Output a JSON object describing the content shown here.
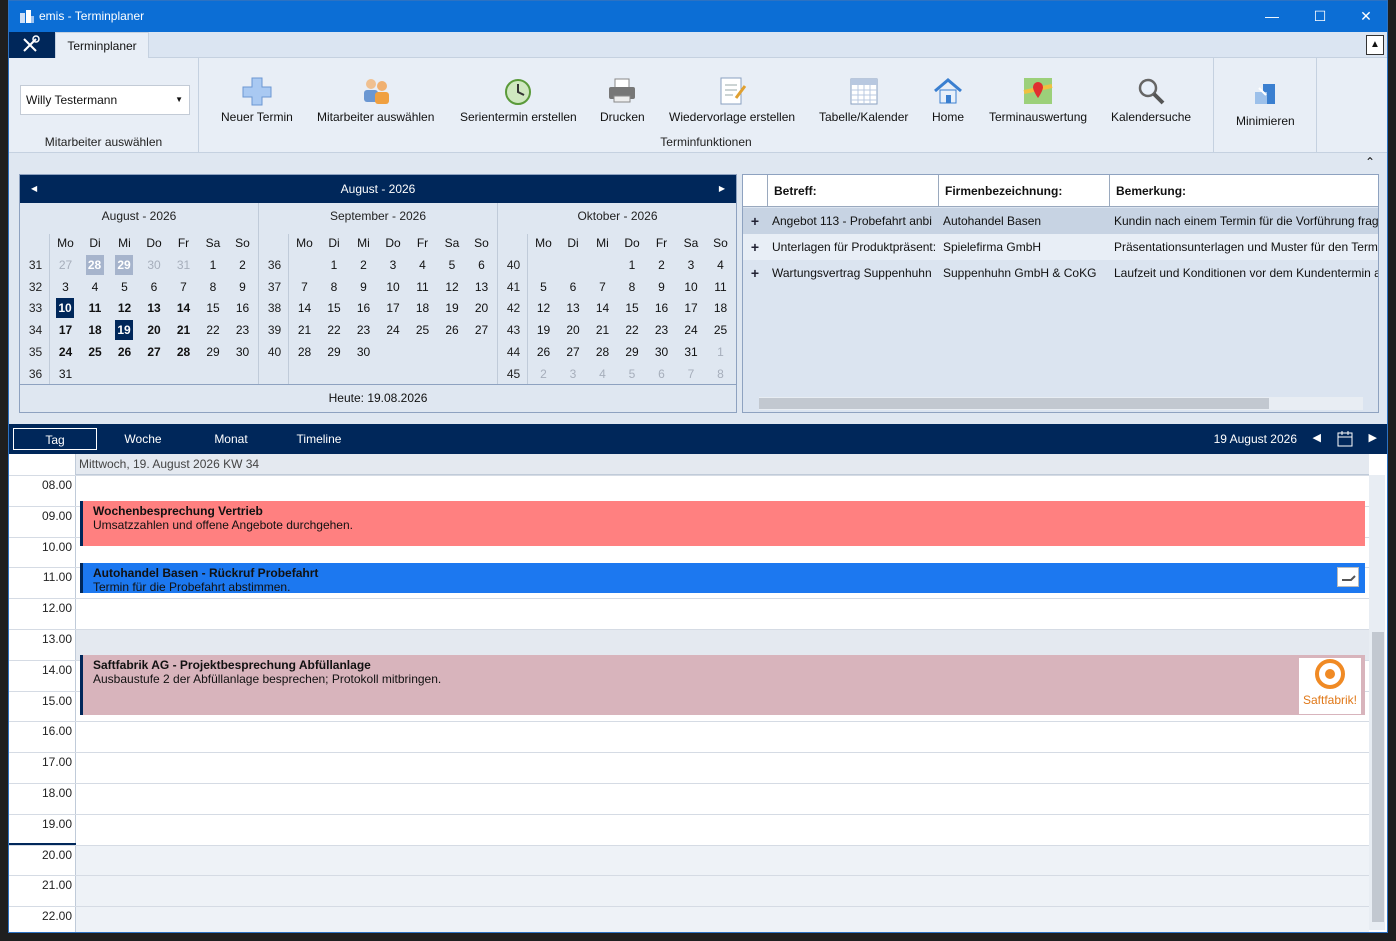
{
  "window": {
    "title": "emis - Terminplaner"
  },
  "ribbon": {
    "tab": "Terminplaner",
    "employee": {
      "value": "Willy Testermann",
      "group_label": "Mitarbeiter auswählen"
    },
    "buttons": [
      "Neuer Termin",
      "Mitarbeiter auswählen",
      "Serientermin erstellen",
      "Drucken",
      "Wiedervorlage erstellen",
      "Tabelle/Kalender",
      "Home",
      "Terminauswertung",
      "Kalendersuche"
    ],
    "group_label": "Terminfunktionen",
    "minimize": "Minimieren"
  },
  "calendar": {
    "header": "August - 2026",
    "today": "Heute: 19.08.2026",
    "weekdays": [
      "Mo",
      "Di",
      "Mi",
      "Do",
      "Fr",
      "Sa",
      "So"
    ],
    "months": [
      {
        "title": "August - 2026",
        "weeks": [
          {
            "wk": "31",
            "days": [
              [
                "27",
                "dim"
              ],
              [
                "28",
                "pastsel"
              ],
              [
                "29",
                "pastsel"
              ],
              [
                "30",
                "dim"
              ],
              [
                "31",
                "dim"
              ],
              [
                "1",
                ""
              ],
              [
                "2",
                ""
              ]
            ]
          },
          {
            "wk": "32",
            "days": [
              [
                "3",
                ""
              ],
              [
                "4",
                ""
              ],
              [
                "5",
                ""
              ],
              [
                "6",
                ""
              ],
              [
                "7",
                ""
              ],
              [
                "8",
                ""
              ],
              [
                "9",
                ""
              ]
            ]
          },
          {
            "wk": "33",
            "days": [
              [
                "10",
                "selday"
              ],
              [
                "11",
                "bold"
              ],
              [
                "12",
                "bold"
              ],
              [
                "13",
                "bold"
              ],
              [
                "14",
                "bold"
              ],
              [
                "15",
                ""
              ],
              [
                "16",
                ""
              ]
            ]
          },
          {
            "wk": "34",
            "days": [
              [
                "17",
                "bold"
              ],
              [
                "18",
                "bold"
              ],
              [
                "19",
                "selday"
              ],
              [
                "20",
                "bold"
              ],
              [
                "21",
                "bold"
              ],
              [
                "22",
                ""
              ],
              [
                "23",
                ""
              ]
            ]
          },
          {
            "wk": "35",
            "days": [
              [
                "24",
                "bold"
              ],
              [
                "25",
                "bold"
              ],
              [
                "26",
                "bold"
              ],
              [
                "27",
                "bold"
              ],
              [
                "28",
                "bold"
              ],
              [
                "29",
                ""
              ],
              [
                "30",
                ""
              ]
            ]
          },
          {
            "wk": "36",
            "days": [
              [
                "31",
                ""
              ],
              [
                "",
                ""
              ],
              [
                "",
                ""
              ],
              [
                "",
                ""
              ],
              [
                "",
                ""
              ],
              [
                "",
                ""
              ],
              [
                "",
                ""
              ]
            ]
          }
        ]
      },
      {
        "title": "September - 2026",
        "weeks": [
          {
            "wk": "36",
            "days": [
              [
                "",
                ""
              ],
              [
                "1",
                ""
              ],
              [
                "2",
                ""
              ],
              [
                "3",
                ""
              ],
              [
                "4",
                ""
              ],
              [
                "5",
                ""
              ],
              [
                "6",
                ""
              ]
            ]
          },
          {
            "wk": "37",
            "days": [
              [
                "7",
                ""
              ],
              [
                "8",
                ""
              ],
              [
                "9",
                ""
              ],
              [
                "10",
                ""
              ],
              [
                "11",
                ""
              ],
              [
                "12",
                ""
              ],
              [
                "13",
                ""
              ]
            ]
          },
          {
            "wk": "38",
            "days": [
              [
                "14",
                ""
              ],
              [
                "15",
                ""
              ],
              [
                "16",
                ""
              ],
              [
                "17",
                ""
              ],
              [
                "18",
                ""
              ],
              [
                "19",
                ""
              ],
              [
                "20",
                ""
              ]
            ]
          },
          {
            "wk": "39",
            "days": [
              [
                "21",
                ""
              ],
              [
                "22",
                ""
              ],
              [
                "23",
                ""
              ],
              [
                "24",
                ""
              ],
              [
                "25",
                ""
              ],
              [
                "26",
                ""
              ],
              [
                "27",
                ""
              ]
            ]
          },
          {
            "wk": "40",
            "days": [
              [
                "28",
                ""
              ],
              [
                "29",
                ""
              ],
              [
                "30",
                ""
              ],
              [
                "",
                ""
              ],
              [
                "",
                ""
              ],
              [
                "",
                ""
              ],
              [
                "",
                ""
              ]
            ]
          },
          {
            "wk": "",
            "days": [
              [
                "",
                ""
              ],
              [
                "",
                ""
              ],
              [
                "",
                ""
              ],
              [
                "",
                ""
              ],
              [
                "",
                ""
              ],
              [
                "",
                ""
              ],
              [
                "",
                ""
              ]
            ]
          }
        ]
      },
      {
        "title": "Oktober - 2026",
        "weeks": [
          {
            "wk": "40",
            "days": [
              [
                "",
                ""
              ],
              [
                "",
                ""
              ],
              [
                "",
                ""
              ],
              [
                "1",
                ""
              ],
              [
                "2",
                ""
              ],
              [
                "3",
                ""
              ],
              [
                "4",
                ""
              ]
            ]
          },
          {
            "wk": "41",
            "days": [
              [
                "5",
                ""
              ],
              [
                "6",
                ""
              ],
              [
                "7",
                ""
              ],
              [
                "8",
                ""
              ],
              [
                "9",
                ""
              ],
              [
                "10",
                ""
              ],
              [
                "11",
                ""
              ]
            ]
          },
          {
            "wk": "42",
            "days": [
              [
                "12",
                ""
              ],
              [
                "13",
                ""
              ],
              [
                "14",
                ""
              ],
              [
                "15",
                ""
              ],
              [
                "16",
                ""
              ],
              [
                "17",
                ""
              ],
              [
                "18",
                ""
              ]
            ]
          },
          {
            "wk": "43",
            "days": [
              [
                "19",
                ""
              ],
              [
                "20",
                ""
              ],
              [
                "21",
                ""
              ],
              [
                "22",
                ""
              ],
              [
                "23",
                ""
              ],
              [
                "24",
                ""
              ],
              [
                "25",
                ""
              ]
            ]
          },
          {
            "wk": "44",
            "days": [
              [
                "26",
                ""
              ],
              [
                "27",
                ""
              ],
              [
                "28",
                ""
              ],
              [
                "29",
                ""
              ],
              [
                "30",
                ""
              ],
              [
                "31",
                ""
              ],
              [
                "1",
                "dim"
              ]
            ]
          },
          {
            "wk": "45",
            "days": [
              [
                "2",
                "dim"
              ],
              [
                "3",
                "dim"
              ],
              [
                "4",
                "dim"
              ],
              [
                "5",
                "dim"
              ],
              [
                "6",
                "dim"
              ],
              [
                "7",
                "dim"
              ],
              [
                "8",
                "dim"
              ]
            ]
          }
        ]
      }
    ]
  },
  "grid": {
    "columns": [
      "Betreff:",
      "Firmenbezeichnung:",
      "Bemerkung:"
    ],
    "rows": [
      [
        "Angebot 113 - Probefahrt anbi",
        "Autohandel Basen",
        "Kundin nach einem Termin für die Vorführung frag"
      ],
      [
        "Unterlagen für Produktpräsent:",
        "Spielefirma GmbH",
        "Präsentationsunterlagen und Muster für den Term"
      ],
      [
        "Wartungsvertrag Suppenhuhn",
        "Suppenhuhn GmbH & CoKG",
        "Laufzeit und Konditionen vor dem Kundentermin a"
      ]
    ]
  },
  "views": {
    "tabs": [
      "Tag",
      "Woche",
      "Monat",
      "Timeline"
    ],
    "current_date": "19 August 2026"
  },
  "schedule": {
    "day_label": "Mittwoch, 19. August 2026 KW 34",
    "times": [
      "08.00",
      "09.00",
      "10.00",
      "11.00",
      "12.00",
      "13.00",
      "14.00",
      "15.00",
      "16.00",
      "17.00",
      "18.00",
      "19.00",
      "20.00",
      "21.00",
      "22.00"
    ],
    "appointments": [
      {
        "title": "Wochenbesprechung Vertrieb",
        "desc": "Umsatzzahlen und offene Angebote durchgehen.",
        "color": "#ff8080"
      },
      {
        "title": "Autohandel Basen - Rückruf Probefahrt",
        "desc": "Termin für die Probefahrt abstimmen.",
        "color": "#1c78f0"
      },
      {
        "title": "Saftfabrik AG - Projektbesprechung Abfüllanlage",
        "desc": "Ausbaustufe 2 der Abfüllanlage besprechen; Protokoll mitbringen.",
        "color": "#d8b4bc"
      }
    ],
    "logo_text": "Saftfabrik!"
  }
}
